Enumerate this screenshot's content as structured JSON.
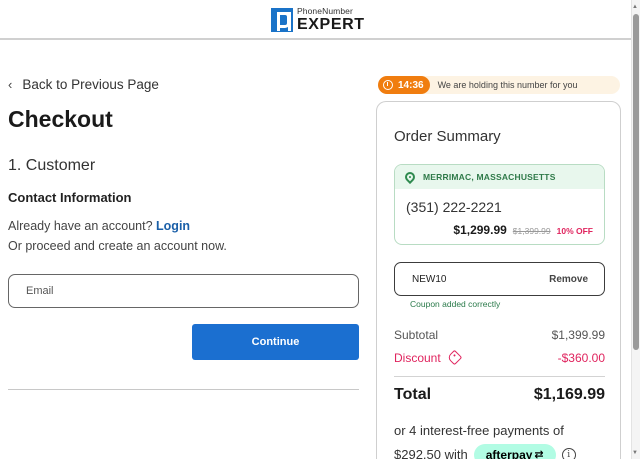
{
  "header": {
    "logo_small": "PhoneNumber",
    "logo_big": "EXPERT"
  },
  "nav": {
    "back_label": "Back to Previous Page"
  },
  "checkout": {
    "title": "Checkout",
    "step": "1. Customer",
    "contact_heading": "Contact Information",
    "have_account": "Already have an account?",
    "login_link": "Login",
    "proceed_text": "Or proceed and create an account now.",
    "email_placeholder": "Email",
    "email_value": "",
    "continue_label": "Continue"
  },
  "hold_banner": {
    "timer": "14:36",
    "text": "We are holding this number for you"
  },
  "summary": {
    "title": "Order Summary",
    "location": "MERRIMAC, MASSACHUSETTS",
    "phone_number": "(351) 222-2221",
    "price": "$1,299.99",
    "original_price": "$1,399.99",
    "discount_badge": "10% OFF",
    "coupon_code": "NEW10",
    "coupon_remove": "Remove",
    "coupon_message": "Coupon added correctly",
    "subtotal_label": "Subtotal",
    "subtotal_value": "$1,399.99",
    "discount_label": "Discount",
    "discount_value": "-$360.00",
    "total_label": "Total",
    "total_value": "$1,169.99",
    "installments_line1": "or 4 interest-free payments of",
    "installments_amount": "$292.50 with",
    "afterpay_label": "afterpay",
    "info_glyph": "i"
  },
  "icons": {
    "back": "chevron-left-icon",
    "timer": "clock-icon",
    "location": "map-pin-icon",
    "discount": "tag-icon",
    "info": "info-icon"
  },
  "colors": {
    "primary": "#1b6fd0",
    "timer_orange": "#f07d0f",
    "discount_pink": "#e0245e",
    "success_green": "#2f7a49",
    "afterpay_mint": "#b2fce4"
  }
}
